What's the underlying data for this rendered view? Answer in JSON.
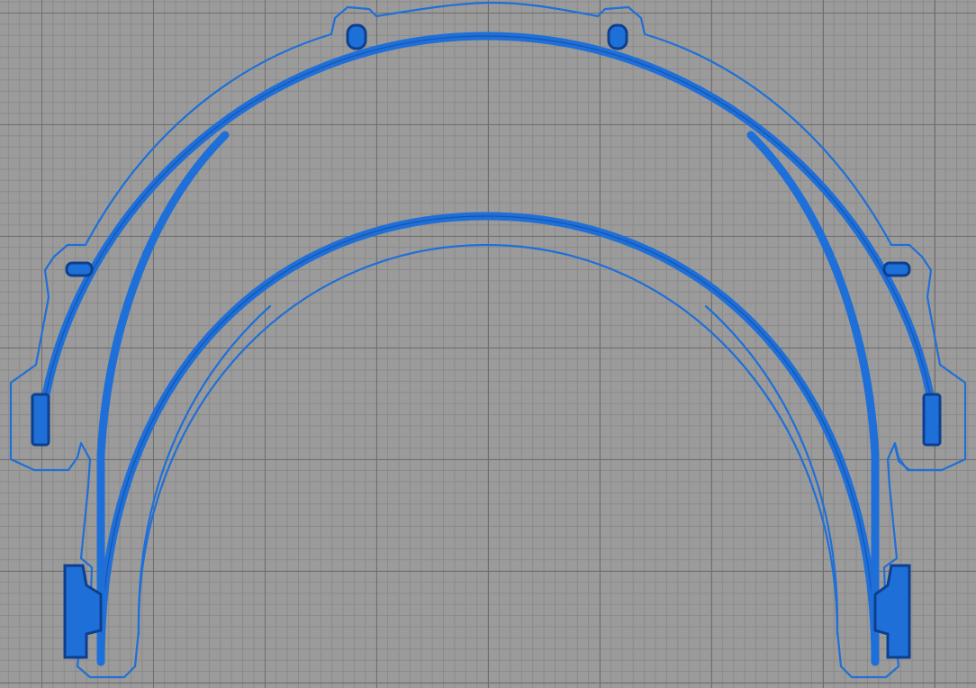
{
  "view": {
    "background_color": "#9b9b9b",
    "grid_major_color": "#6e6e6e",
    "grid_minor_color": "#8a8a8a"
  },
  "toolpath": {
    "part": "face-shield-headband",
    "extrusion_color": "#1f6fd8",
    "extrusion_edge_color": "#0d3f8f"
  }
}
